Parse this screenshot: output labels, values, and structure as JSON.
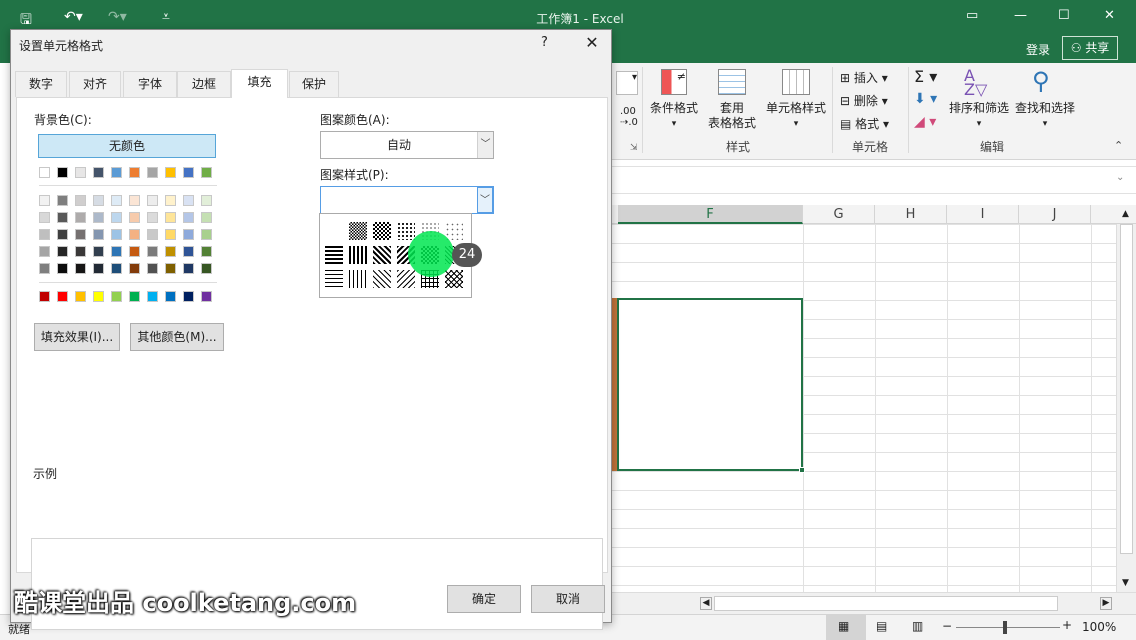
{
  "window": {
    "title": "工作簿1 - Excel",
    "login": "登录",
    "share": "共享"
  },
  "ribbon": {
    "cond_format": "条件格式",
    "table_format_1": "套用",
    "table_format_2": "表格格式",
    "cell_style": "单元格样式",
    "group_styles": "样式",
    "insert": "插入",
    "delete": "删除",
    "format": "格式",
    "group_cells": "单元格",
    "sort_filter": "排序和筛选",
    "find_select": "查找和选择",
    "group_edit": "编辑"
  },
  "columns": [
    "F",
    "G",
    "H",
    "I",
    "J"
  ],
  "status": {
    "ready": "就绪",
    "zoom": "100%"
  },
  "dialog": {
    "title": "设置单元格格式",
    "help": "?",
    "close": "✕",
    "tabs": [
      "数字",
      "对齐",
      "字体",
      "边框",
      "填充",
      "保护"
    ],
    "active_tab": "填充",
    "bg_color_label": "背景色(C):",
    "no_color": "无颜色",
    "pattern_color_label": "图案颜色(A):",
    "pattern_color_value": "自动",
    "pattern_style_label": "图案样式(P):",
    "fill_effects": "填充效果(I)...",
    "more_colors": "其他颜色(M)...",
    "sample_label": "示例",
    "ok": "确定",
    "cancel": "取消"
  },
  "colors": {
    "row_theme": [
      "#ffffff",
      "#000000",
      "#e7e6e6",
      "#44546a",
      "#5b9bd5",
      "#ed7d31",
      "#a5a5a5",
      "#ffc000",
      "#4472c4",
      "#70ad47"
    ],
    "tints": [
      [
        "#f2f2f2",
        "#7f7f7f",
        "#d0cece",
        "#d6dce4",
        "#deebf6",
        "#fbe5d5",
        "#ededed",
        "#fff2cc",
        "#d9e2f3",
        "#e2efd9"
      ],
      [
        "#d8d8d8",
        "#595959",
        "#aeabab",
        "#adb9ca",
        "#bdd7ee",
        "#f7cbac",
        "#dbdbdb",
        "#fee599",
        "#b4c6e7",
        "#c5e0b3"
      ],
      [
        "#bfbfbf",
        "#3f3f3f",
        "#757070",
        "#8496b0",
        "#9cc3e5",
        "#f4b183",
        "#c9c9c9",
        "#ffd965",
        "#8eaadb",
        "#a8d08d"
      ],
      [
        "#a5a5a5",
        "#262626",
        "#3a3838",
        "#323f4f",
        "#2e75b5",
        "#c55a11",
        "#7b7b7b",
        "#bf9000",
        "#2f5496",
        "#538135"
      ],
      [
        "#7f7f7f",
        "#0c0c0c",
        "#171616",
        "#222a35",
        "#1e4e79",
        "#833c0b",
        "#525252",
        "#7f6000",
        "#1f3864",
        "#375623"
      ]
    ],
    "standard": [
      "#c00000",
      "#ff0000",
      "#ffc000",
      "#ffff00",
      "#92d050",
      "#00b050",
      "#00b0f0",
      "#0070c0",
      "#002060",
      "#7030a0"
    ]
  },
  "overlay": {
    "click_count": "24",
    "watermark": "酷课堂出品 coolketang.com"
  }
}
